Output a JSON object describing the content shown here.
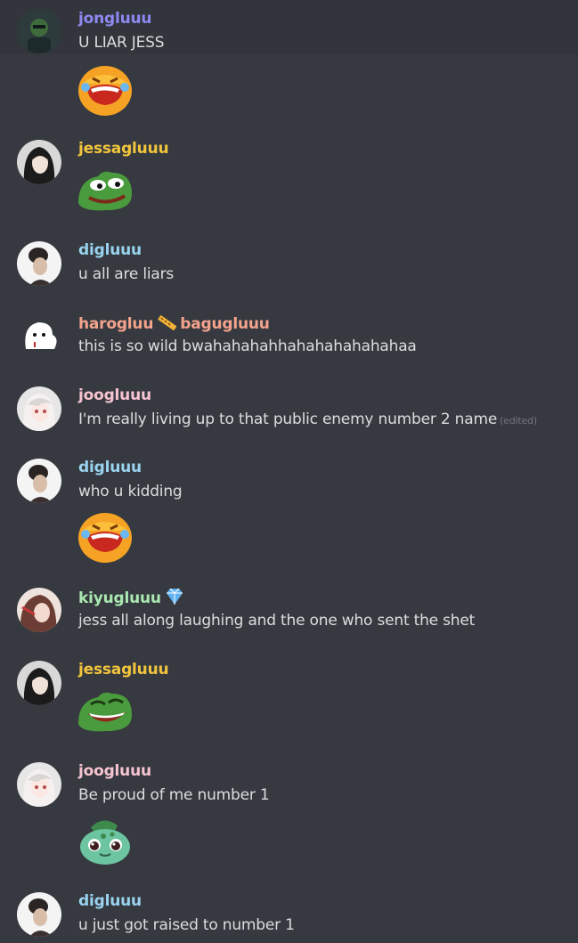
{
  "colors": {
    "background": "#36393f",
    "hover": "#32353b",
    "text": "#dcddde",
    "purple": "#8e89f2",
    "yellow": "#f2c53d",
    "blue": "#9ad3f0",
    "salmon": "#f4a38d",
    "pink": "#f7c4d1",
    "green": "#a9e8b0"
  },
  "messages": [
    {
      "author": "jongluuu",
      "text": "U LIAR JESS",
      "emoji": "laughing-crying-emoji"
    },
    {
      "author": "jessagluuu",
      "text": "",
      "emoji": "pepe-smile-emoji"
    },
    {
      "author": "digluuu",
      "text": "u all are liars"
    },
    {
      "author": "harogluu",
      "author2": "bagugluuu",
      "badge": "ruler-icon",
      "text": "this is so wild bwahahahahhahahahahahahaa"
    },
    {
      "author": "joogluuu",
      "text": "I'm really living up to that public enemy number 2 name",
      "edited": "(edited)"
    },
    {
      "author": "digluuu",
      "text": "who u kidding",
      "emoji": "laughing-crying-emoji"
    },
    {
      "author": "kiyugluuu",
      "badge": "diamond-icon",
      "text": "jess all along laughing and the one who sent the shet"
    },
    {
      "author": "jessagluuu",
      "text": "",
      "emoji": "pepe-laugh-emoji"
    },
    {
      "author": "joogluuu",
      "text": "Be proud of me number 1",
      "emoji": "bulbasaur-emoji"
    },
    {
      "author": "digluuu",
      "text": "u just got raised to number 1"
    }
  ]
}
